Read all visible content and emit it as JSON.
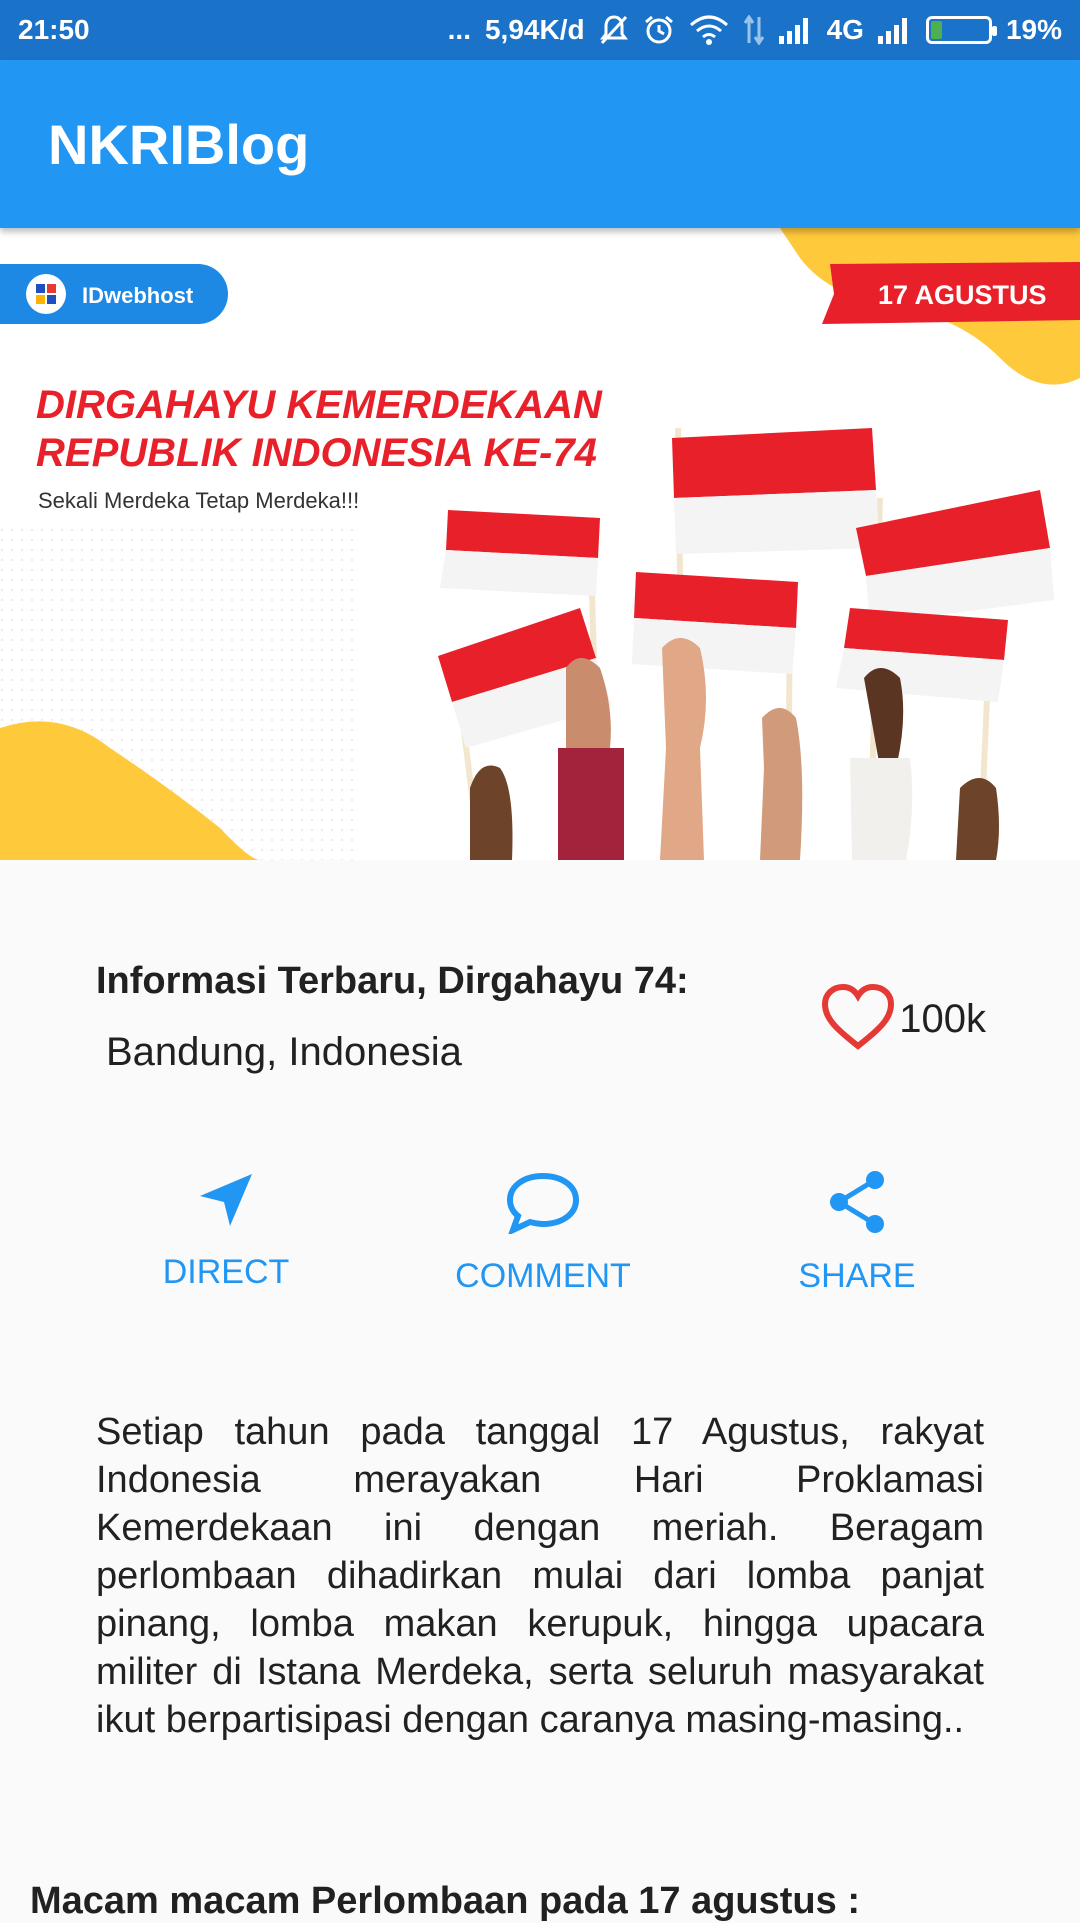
{
  "status_bar": {
    "time": "21:50",
    "dots": "...",
    "speed": "5,94K/d",
    "network": "4G",
    "battery": "19%",
    "battery_level": 0.19,
    "icons": [
      "mute-icon",
      "alarm-icon",
      "wifi-icon",
      "data-arrows-icon",
      "signal-icon",
      "signal-icon",
      "battery-icon"
    ]
  },
  "app_bar": {
    "title": "NKRIBlog"
  },
  "banner": {
    "sponsor": "IDwebhost",
    "badge": "17 AGUSTUS",
    "headline_1": "DIRGAHAYU KEMERDEKAAN",
    "headline_2": "REPUBLIK INDONESIA KE-74",
    "tagline": "Sekali Merdeka Tetap Merdeka!!!",
    "colors": {
      "red": "#e8202a",
      "yellow": "#ffc93c",
      "white": "#ffffff"
    }
  },
  "post": {
    "title": "Informasi Terbaru, Dirgahayu 74:",
    "location": "Bandung, Indonesia",
    "likes": "100k",
    "like_icon": "heart-outline-icon",
    "like_color": "#e53935"
  },
  "actions": [
    {
      "label": "DIRECT",
      "icon": "navigation-arrow-icon"
    },
    {
      "label": "COMMENT",
      "icon": "comment-bubble-icon"
    },
    {
      "label": "SHARE",
      "icon": "share-icon"
    }
  ],
  "accent_color": "#2196f3",
  "body": "Setiap tahun pada tanggal 17 Agustus, rakyat Indonesia merayakan Hari Proklamasi Kemerdekaan ini dengan meriah. Beragam perlombaan dihadirkan mulai dari lomba panjat pinang, lomba makan kerupuk, hingga upacara militer di Istana Merdeka, serta seluruh masyarakat ikut berpartisipasi dengan caranya masing-masing..",
  "section_heading": "Macam macam Perlombaan pada 17 agustus :"
}
